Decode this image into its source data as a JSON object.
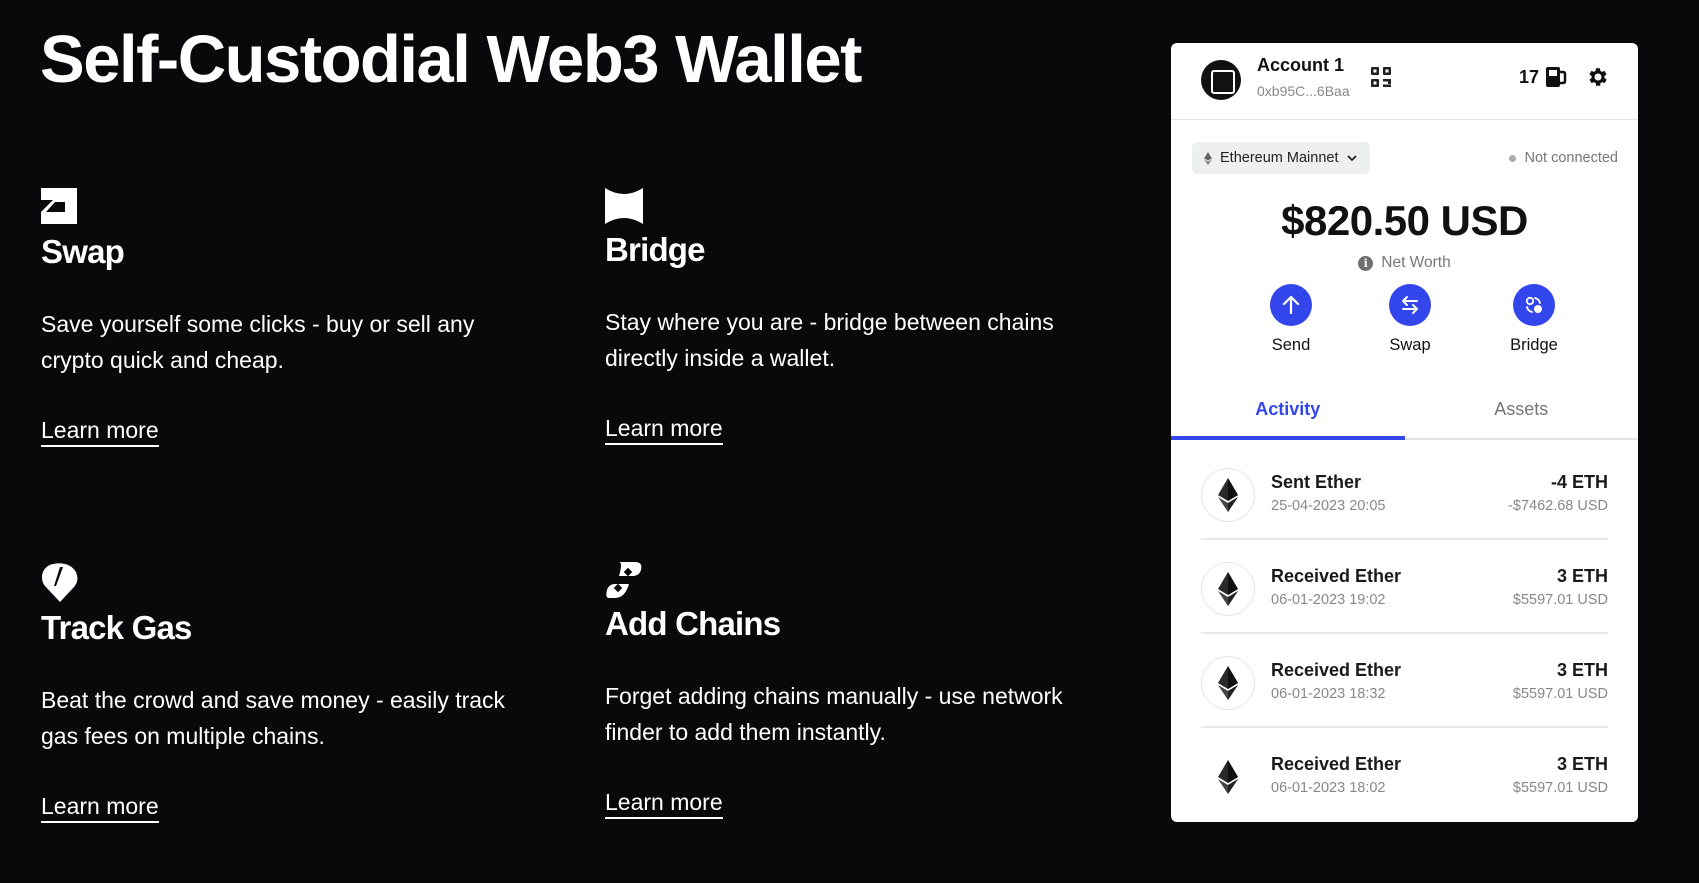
{
  "page": {
    "title": "Self-Custodial Web3 Wallet"
  },
  "features": [
    {
      "icon": "swap-icon",
      "title": "Swap",
      "description": "Save yourself some clicks - buy or sell any crypto quick and cheap.",
      "link": "Learn more"
    },
    {
      "icon": "bridge-icon",
      "title": "Bridge",
      "description": "Stay where you are - bridge between chains directly inside a wallet.",
      "link": "Learn more"
    },
    {
      "icon": "gas-drop-icon",
      "title": "Track Gas",
      "description": "Beat the crowd and save money - easily track gas fees on multiple chains.",
      "link": "Learn more"
    },
    {
      "icon": "chain-link-icon",
      "title": "Add Chains",
      "description": "Forget adding chains manually - use network finder to add them instantly.",
      "link": "Learn more"
    }
  ],
  "wallet": {
    "account_name": "Account 1",
    "account_address": "0xb95C...6Baa",
    "gas_price": "17",
    "network": "Ethereum Mainnet",
    "connection_status": "Not connected",
    "balance": "$820.50 USD",
    "balance_label": "Net Worth",
    "actions": [
      {
        "label": "Send",
        "icon": "arrow-up-icon"
      },
      {
        "label": "Swap",
        "icon": "swap-arrows-icon"
      },
      {
        "label": "Bridge",
        "icon": "bridge-nodes-icon"
      }
    ],
    "tabs": [
      {
        "label": "Activity",
        "active": true
      },
      {
        "label": "Assets",
        "active": false
      }
    ],
    "transactions": [
      {
        "title": "Sent Ether",
        "date": "25-04-2023 20:05",
        "amount": "-4 ETH",
        "usd": "-$7462.68 USD"
      },
      {
        "title": "Received Ether",
        "date": "06-01-2023 19:02",
        "amount": "3 ETH",
        "usd": "$5597.01 USD"
      },
      {
        "title": "Received Ether",
        "date": "06-01-2023 18:32",
        "amount": "3 ETH",
        "usd": "$5597.01 USD"
      },
      {
        "title": "Received Ether",
        "date": "06-01-2023 18:02",
        "amount": "3 ETH",
        "usd": "$5597.01 USD"
      }
    ],
    "colors": {
      "accent": "#3346ec",
      "background": "#09090b",
      "panel": "#ffffff"
    }
  }
}
